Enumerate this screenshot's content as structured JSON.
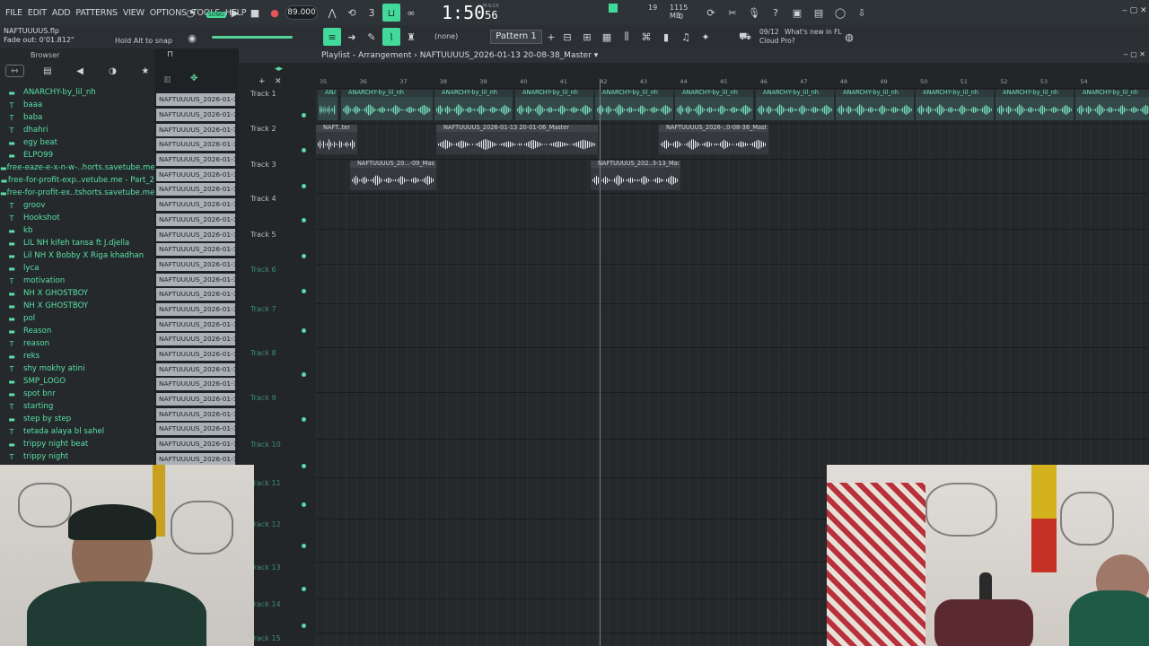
{
  "menu": [
    "FILE",
    "EDIT",
    "ADD",
    "PATTERNS",
    "VIEW",
    "OPTIONS",
    "TOOLS",
    "HELP"
  ],
  "transport": {
    "mode": "SONG",
    "bpm": "89.000",
    "time_main": "1:50",
    "time_sub": "56",
    "time_unit": "M:S:CS"
  },
  "cpu": {
    "value": "19",
    "memory": "1115 MB",
    "polyphony": "0"
  },
  "hint": {
    "file": "NAFTUUUUS.flp",
    "fade": "Fade out: 0'01.812\"",
    "snap": "Hold Alt to snap"
  },
  "toolbar": {
    "selection": "(none)",
    "pattern": "Pattern 1"
  },
  "news": {
    "date": "09/12",
    "title": "What's new in FL",
    "subtitle": "Cloud Pro?"
  },
  "browser": {
    "title": "Browser",
    "files": [
      {
        "icon": "folder",
        "name": "ANARCHY-by_lil_nh"
      },
      {
        "icon": "text",
        "name": "baaa"
      },
      {
        "icon": "text",
        "name": "baba"
      },
      {
        "icon": "text",
        "name": "dhahri"
      },
      {
        "icon": "folder",
        "name": "egy beat"
      },
      {
        "icon": "folder",
        "name": "ELPO99"
      },
      {
        "icon": "folder",
        "name": "free-eaze-e-x-n-w-..horts.savetube.me"
      },
      {
        "icon": "folder",
        "name": "free-for-profit-exp..vetube.me - Part_2"
      },
      {
        "icon": "folder",
        "name": "free-for-profit-ex..tshorts.savetube.me"
      },
      {
        "icon": "text",
        "name": "groov"
      },
      {
        "icon": "text",
        "name": "Hookshot"
      },
      {
        "icon": "folder",
        "name": "kb"
      },
      {
        "icon": "folder",
        "name": "LIL NH kifeh tansa ft J.djella"
      },
      {
        "icon": "folder",
        "name": "Lil NH X Bobby X Riga khadhan"
      },
      {
        "icon": "folder",
        "name": "lyca"
      },
      {
        "icon": "text",
        "name": "motivation"
      },
      {
        "icon": "folder",
        "name": "NH X GHOSTBOY"
      },
      {
        "icon": "folder",
        "name": "NH X GHOSTBOY"
      },
      {
        "icon": "folder",
        "name": "pol"
      },
      {
        "icon": "folder",
        "name": "Reason"
      },
      {
        "icon": "text",
        "name": "reason"
      },
      {
        "icon": "folder",
        "name": "reks"
      },
      {
        "icon": "text",
        "name": "shy mokhy atini"
      },
      {
        "icon": "folder",
        "name": "SMP_LOGO"
      },
      {
        "icon": "folder",
        "name": "spot bnr"
      },
      {
        "icon": "text",
        "name": "starting"
      },
      {
        "icon": "folder",
        "name": "step by step"
      },
      {
        "icon": "text",
        "name": "tetada alaya bl sahel"
      },
      {
        "icon": "folder",
        "name": "trippy night beat"
      },
      {
        "icon": "text",
        "name": "trippy night"
      }
    ]
  },
  "clips_list": {
    "label": "NAFTUUUUS_2026-01-13...",
    "count": 25
  },
  "playlist": {
    "title": "Playlist - Arrangement",
    "arrangement": "NAFTUUUUS_2026-01-13 20-08-38_Master",
    "ruler": [
      "35",
      "36",
      "37",
      "38",
      "39",
      "40",
      "41",
      "42",
      "43",
      "44",
      "45",
      "46",
      "47",
      "48",
      "49",
      "50",
      "51",
      "52",
      "53",
      "54"
    ],
    "tracks": [
      "Track 1",
      "Track 2",
      "Track 3",
      "Track 4",
      "Track 5",
      "Track 6",
      "Track 7",
      "Track 8",
      "Track 9",
      "Track 10",
      "Track 11",
      "Track 12",
      "Track 13",
      "Track 14",
      "Track 15"
    ],
    "clips": [
      {
        "track": 0,
        "label": "ANA..l_nh",
        "green": true
      },
      {
        "track": 0,
        "label": "ANARCHY-by_lil_nh",
        "green": true
      },
      {
        "track": 0,
        "label": "ANARCHY-by_lil_nh",
        "green": true
      },
      {
        "track": 0,
        "label": "ANARCHY-by_lil_nh",
        "green": true
      },
      {
        "track": 0,
        "label": "ANARCHY-by_lil_nh",
        "green": true
      },
      {
        "track": 0,
        "label": "ANARCHY-by_lil_nh",
        "green": true
      },
      {
        "track": 0,
        "label": "ANARCHY-by_lil_nh",
        "green": true
      },
      {
        "track": 0,
        "label": "ANARCHY-by_lil_nh",
        "green": true
      },
      {
        "track": 0,
        "label": "ANARCHY-by_lil_nh",
        "green": true
      },
      {
        "track": 0,
        "label": "ANARCHY-by_lil_nh",
        "green": true
      },
      {
        "track": 0,
        "label": "ANARCHY-by_lil_nh",
        "green": true
      },
      {
        "track": 0,
        "label": "ANARCH..lil_nh",
        "green": true
      },
      {
        "track": 1,
        "label": "NAFT..ter",
        "green": false
      },
      {
        "track": 1,
        "label": "NAFTUUUUS_2026-01-13 20-01-06_Master",
        "green": false
      },
      {
        "track": 1,
        "label": "NAFTUUUUS_2026-..0-08-38_Master",
        "green": false
      },
      {
        "track": 2,
        "label": "NAFTUUUUS_20...-09_Master",
        "green": false
      },
      {
        "track": 2,
        "label": "NAFTUUUUS_202..3-13_Master",
        "green": false
      }
    ]
  },
  "colors": {
    "accent": "#43d99a",
    "folder_text": "#58e0a4",
    "background": "#202326"
  }
}
